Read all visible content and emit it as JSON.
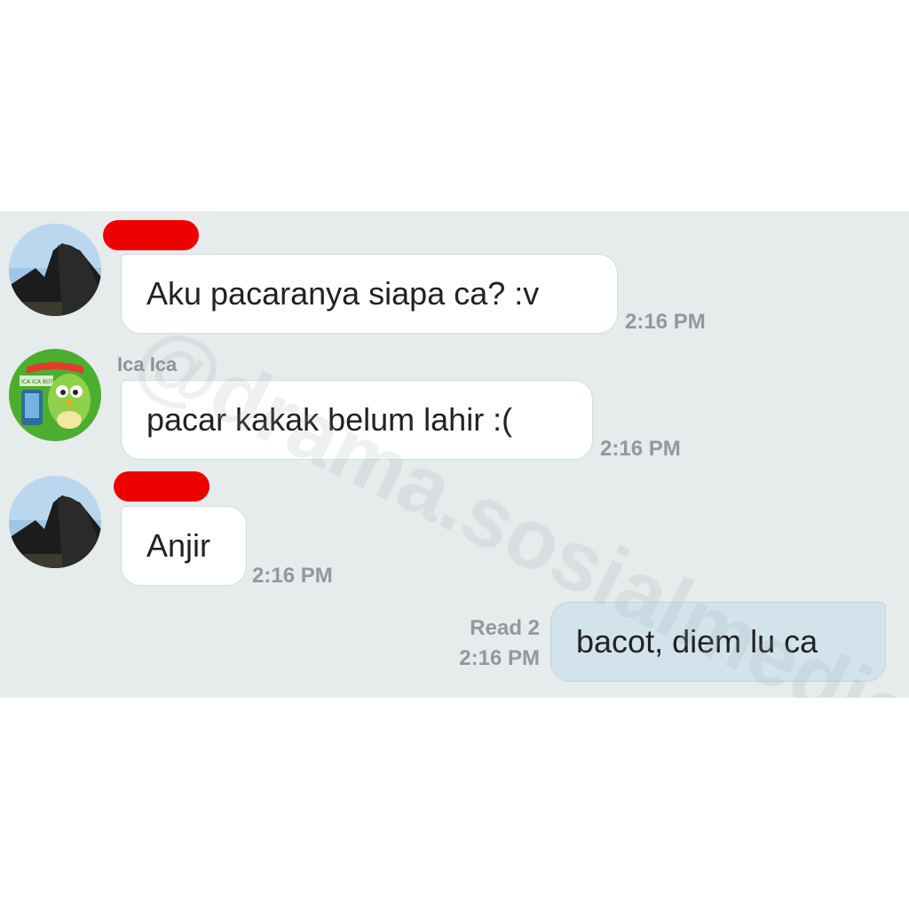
{
  "watermark": "@drama.sosialmedia",
  "messages": [
    {
      "direction": "in",
      "sender": "",
      "sender_redacted": true,
      "text": "Aku pacaranya siapa ca? :v",
      "time": "2:16 PM"
    },
    {
      "direction": "in",
      "sender": "Ica Ica",
      "sender_redacted": false,
      "avatar_badge": "ICA ICA BOT",
      "text": "pacar kakak belum lahir :(",
      "time": "2:16 PM"
    },
    {
      "direction": "in",
      "sender": "",
      "sender_redacted": true,
      "text": "Anjir",
      "time": "2:16 PM"
    },
    {
      "direction": "out",
      "read_status": "Read 2",
      "text": "bacot, diem lu ca",
      "time": "2:16 PM"
    }
  ],
  "colors": {
    "chat_background": "#e6ebeb",
    "incoming_bubble": "#ffffff",
    "outgoing_bubble": "#d3e3ec",
    "redaction": "#ee0000",
    "timestamp": "#8f9a9e"
  },
  "icons": {
    "user_avatar": "profile-photo-avatar",
    "bot_avatar": "green-bird-bot-avatar"
  }
}
